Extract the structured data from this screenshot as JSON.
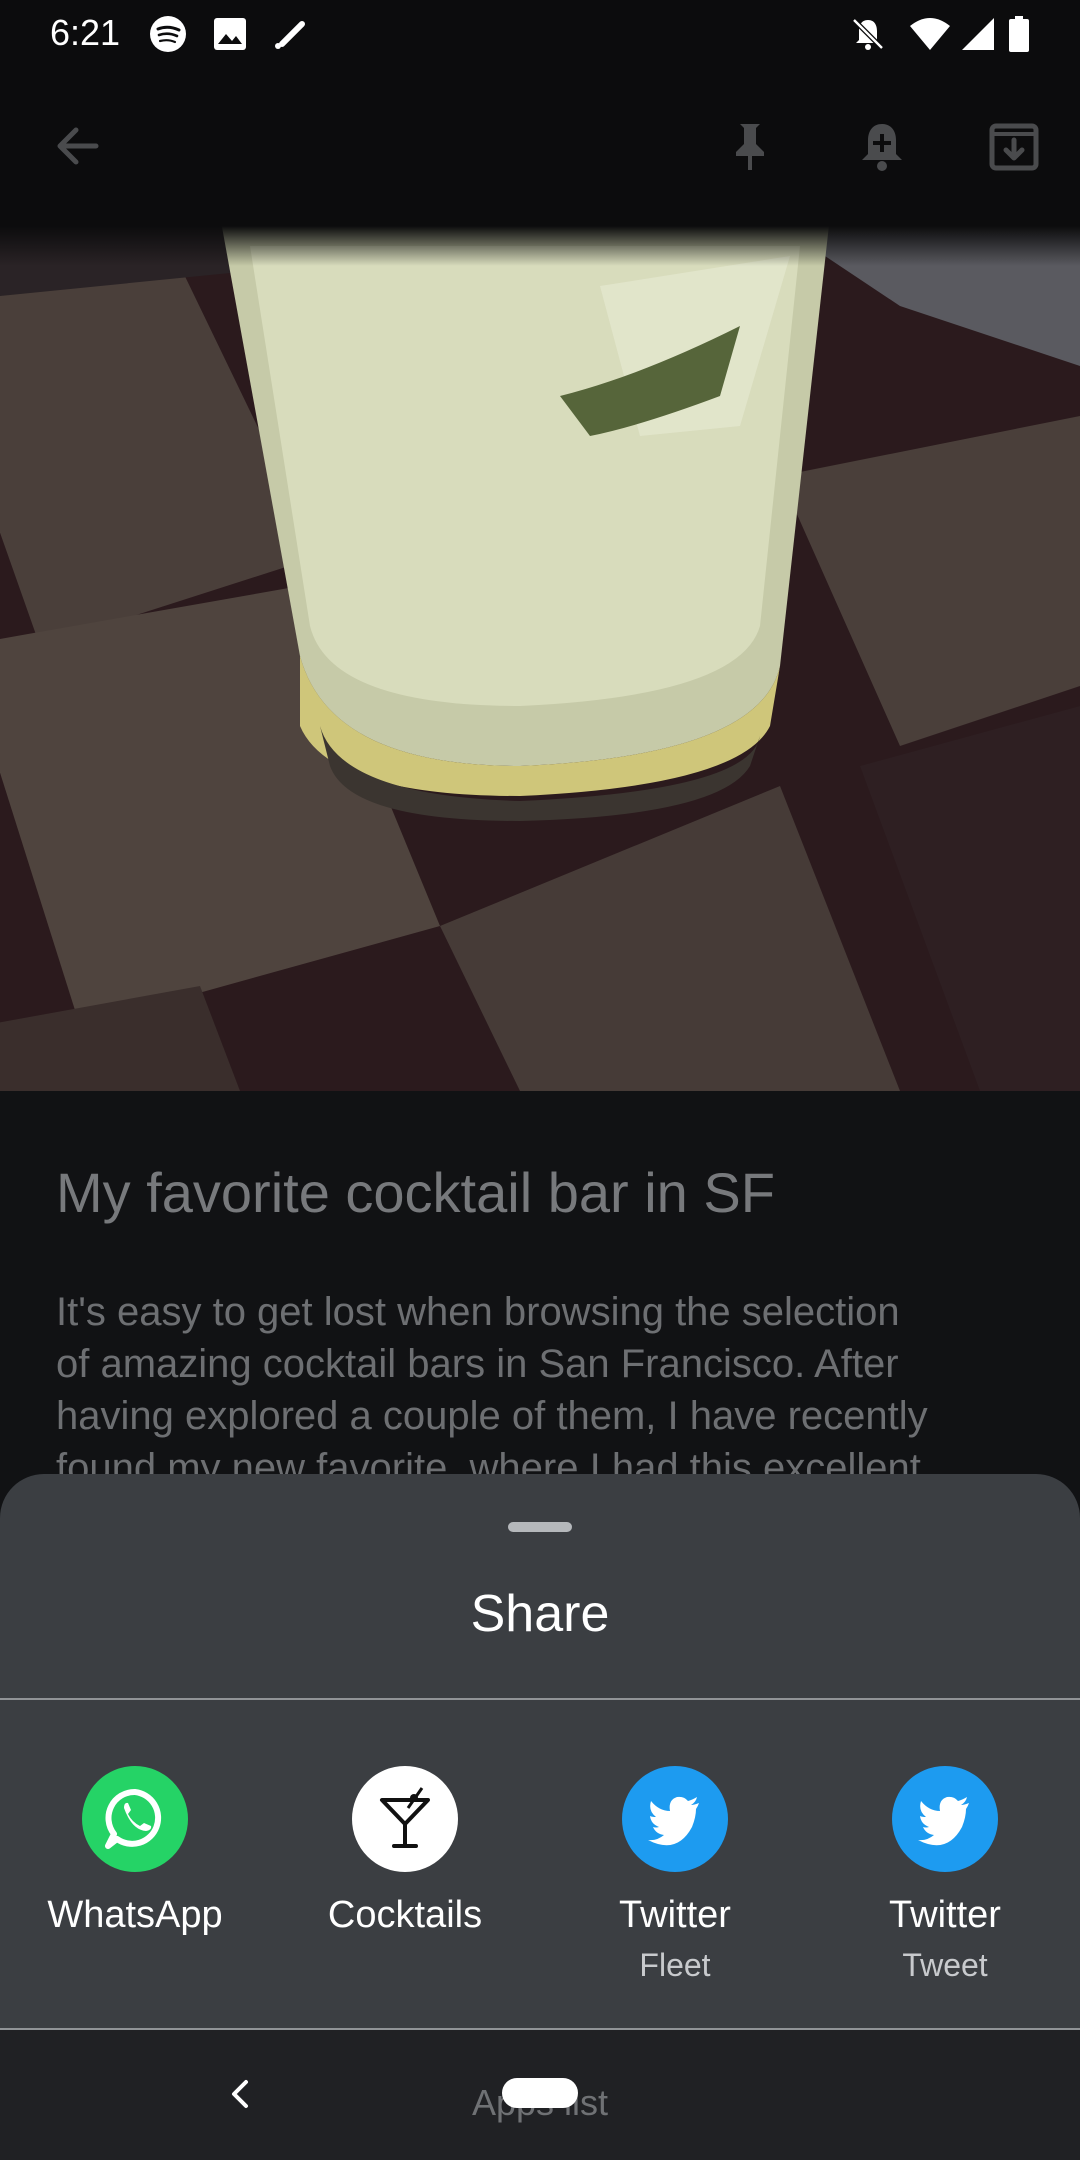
{
  "status_bar": {
    "time": "6:21",
    "left_icons": [
      "spotify-icon",
      "image-icon",
      "edit-icon"
    ],
    "right_icons": [
      "notifications-off-icon",
      "wifi-icon",
      "cell-signal-icon",
      "battery-icon"
    ]
  },
  "toolbar": {
    "icons": [
      "back-arrow-icon",
      "pin-icon",
      "add-reminder-icon",
      "archive-icon"
    ]
  },
  "note": {
    "title": "My favorite cocktail bar in SF",
    "body_lines": [
      "It's easy to get lost when browsing the selection",
      "of amazing cocktail bars in San Francisco. After",
      "having explored a couple of them, I have recently",
      "found my new favorite, where I had this excellent"
    ]
  },
  "share_sheet": {
    "title": "Share",
    "targets": [
      {
        "label": "WhatsApp",
        "sub": "",
        "icon": "whatsapp-icon",
        "color": "#25d366"
      },
      {
        "label": "Cocktails",
        "sub": "",
        "icon": "cocktail-glass-icon",
        "color": "#ffffff"
      },
      {
        "label": "Twitter",
        "sub": "Fleet",
        "icon": "twitter-icon",
        "color": "#1d9bf0"
      },
      {
        "label": "Twitter",
        "sub": "Tweet",
        "icon": "twitter-icon",
        "color": "#1d9bf0"
      }
    ]
  },
  "nav_bar": {
    "hint": "Apps list"
  },
  "colors": {
    "sheet_bg": "#3b3e42",
    "nav_bg": "#202124",
    "page_bg": "#111214"
  }
}
